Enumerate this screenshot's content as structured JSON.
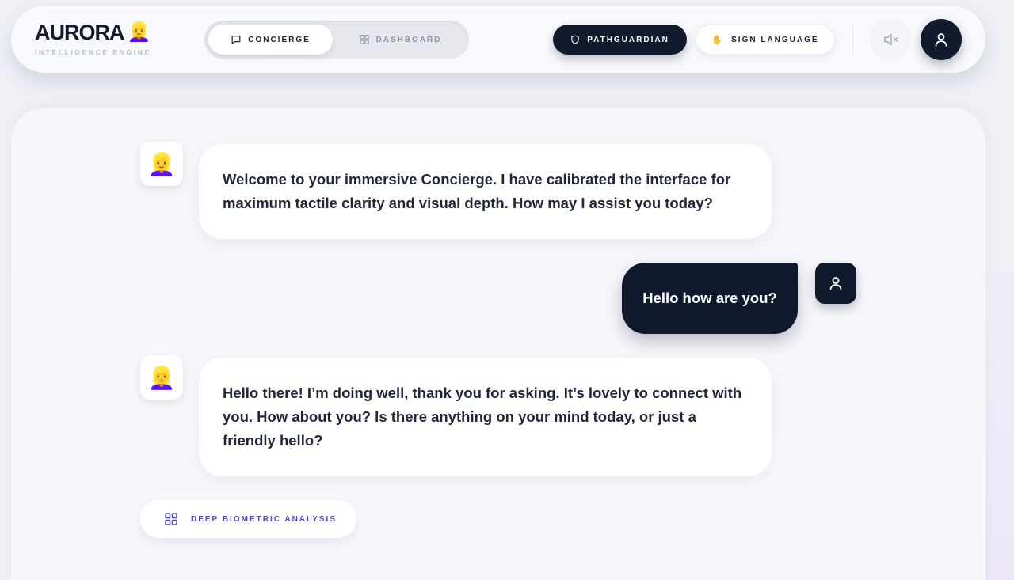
{
  "brand": {
    "title": "AURORA",
    "emoji": "👱‍♀️",
    "subtitle": "INTELLIGENCE ENGINE"
  },
  "tabs": [
    {
      "label": "CONCIERGE",
      "icon": "chat-icon",
      "active": true
    },
    {
      "label": "DASHBOARD",
      "icon": "grid-icon",
      "active": false
    }
  ],
  "actions": {
    "pathguardian_label": "PATHGUARDIAN",
    "pathguardian_icon": "shield-icon",
    "sign_language_label": "SIGN LANGUAGE",
    "sign_language_icon": "✋",
    "mute_icon": "speaker-muted-icon",
    "profile_icon": "user-icon"
  },
  "messages": [
    {
      "role": "assistant",
      "avatar": "👱‍♀️",
      "text": "Welcome to your immersive Concierge. I have calibrated the interface for maximum tactile clarity and visual depth. How may I assist you today?"
    },
    {
      "role": "user",
      "avatar": "user-icon",
      "text": "Hello how are you?"
    },
    {
      "role": "assistant",
      "avatar": "👱‍♀️",
      "text": "Hello there! I’m doing well, thank you for asking. It’s lovely to connect with you. How about you? Is there anything on your mind today, or just a friendly hello?"
    }
  ],
  "analysis_button": {
    "label": "DEEP BIOMETRIC ANALYSIS",
    "icon": "grid-icon"
  },
  "colors": {
    "dark": "#111a2c",
    "accent": "#4f46c8",
    "background": "#eef0f6",
    "surface": "#ffffff"
  }
}
